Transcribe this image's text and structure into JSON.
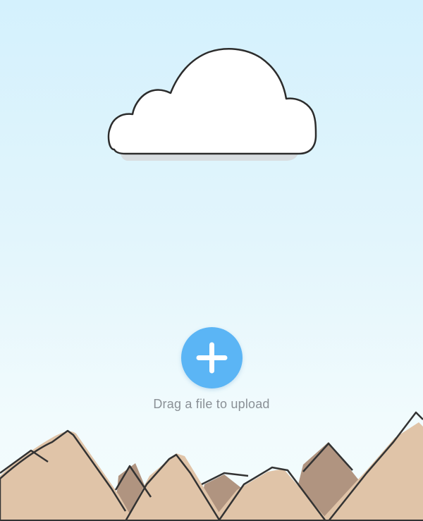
{
  "upload": {
    "hint_text": "Drag a file to upload",
    "icon": "plus-icon",
    "button_color": "#5bb5f5"
  },
  "scene": {
    "cloud_icon": "cloud-icon",
    "mountains_icon": "mountains-illustration",
    "sky_color": "#d4f1fd",
    "mountain_front_color": "#e0c4a8",
    "mountain_back_color": "#b09480",
    "outline_color": "#333333"
  }
}
